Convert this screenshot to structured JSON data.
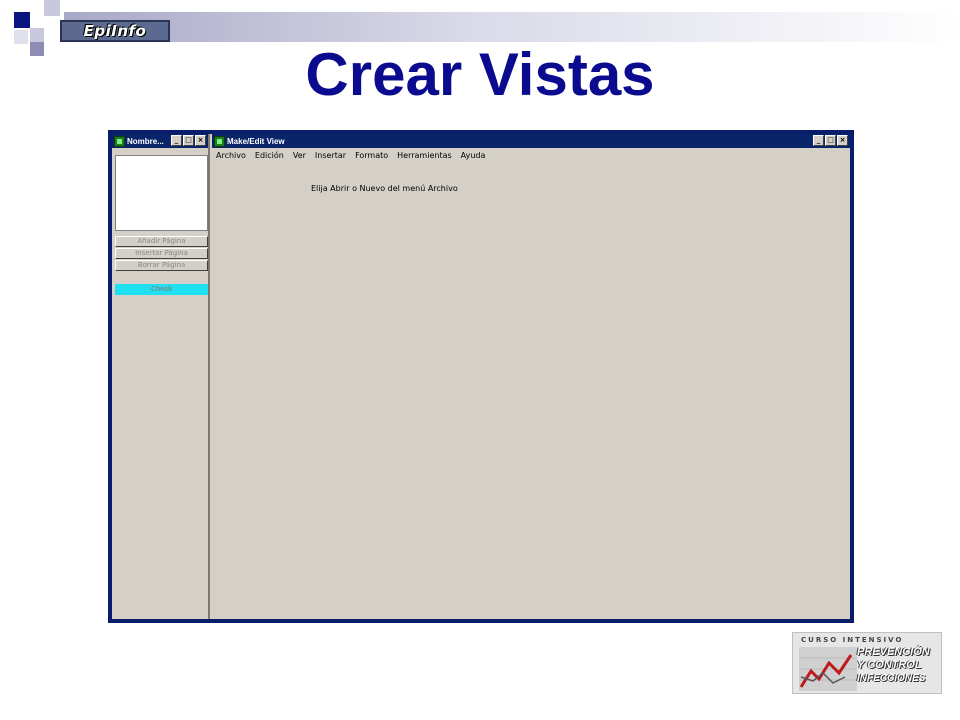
{
  "slide": {
    "title": "Crear Vistas",
    "top_logo_text": "EpiInfo",
    "course_logo": {
      "line_top": "CURSO INTENSIVO",
      "line1": "PREVENCIÓN",
      "line2": "Y CONTROL",
      "line3": "INFECCIONES",
      "accent_color": "#c0191c"
    }
  },
  "side_window": {
    "title": "Nombre...",
    "buttons": {
      "add_page": "Añadir Página",
      "insert_page": "Insertar Página",
      "delete_page": "Borrar Página",
      "check": "Check"
    }
  },
  "main_window": {
    "title": "Make/Edit View",
    "menu": [
      "Archivo",
      "Edición",
      "Ver",
      "Insertar",
      "Formato",
      "Herramientas",
      "Ayuda"
    ],
    "hint": "Elija Abrir o Nuevo del menú Archivo"
  },
  "colors": {
    "title_color": "#0b0b8f",
    "titlebar": "#0a246a",
    "window_face": "#d4d0c8",
    "frame": "#0a1d6b",
    "check_button": "#1ee0f0"
  }
}
